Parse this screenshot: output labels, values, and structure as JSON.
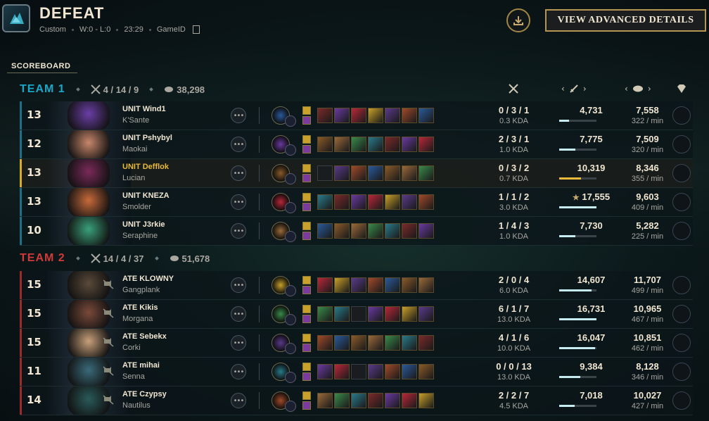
{
  "header": {
    "title": "DEFEAT",
    "mode": "Custom",
    "record": "W:0 - L:0",
    "duration": "23:29",
    "game_id_label": "GameID",
    "advanced_button": "VIEW ADVANCED DETAILS"
  },
  "scoreboard_label": "SCOREBOARD",
  "teams": [
    {
      "name": "TEAM 1",
      "kda": "4 / 14 / 9",
      "gold": "38,298",
      "color": "#1aa7c8",
      "players": [
        {
          "level": "13",
          "name": "UNIT Wind1",
          "champion": "K'Sante",
          "kda": "0 / 3 / 1",
          "kda_ratio": "0.3 KDA",
          "damage": "4,731",
          "damage_pct": 0.27,
          "gold": "7,558",
          "gpm": "322 / min",
          "portrait_color": "#6b3fa6"
        },
        {
          "level": "12",
          "name": "UNIT Pshybyl",
          "champion": "Maokai",
          "kda": "2 / 3 / 1",
          "kda_ratio": "1.0 KDA",
          "damage": "7,775",
          "damage_pct": 0.44,
          "gold": "7,509",
          "gpm": "320 / min",
          "portrait_color": "#c8876b"
        },
        {
          "level": "13",
          "name": "UNIT Defflok",
          "champion": "Lucian",
          "kda": "0 / 3 / 2",
          "kda_ratio": "0.7 KDA",
          "damage": "10,319",
          "damage_pct": 0.59,
          "gold": "8,346",
          "gpm": "355 / min",
          "portrait_color": "#7a2a5a",
          "highlight": true
        },
        {
          "level": "13",
          "name": "UNIT KNEZA",
          "champion": "Smolder",
          "kda": "1 / 1 / 2",
          "kda_ratio": "3.0 KDA",
          "damage": "17,555",
          "damage_star": "★",
          "damage_pct": 1.0,
          "gold": "9,603",
          "gpm": "409 / min",
          "portrait_color": "#c86a3a"
        },
        {
          "level": "10",
          "name": "UNIT J3rkie",
          "champion": "Seraphine",
          "kda": "1 / 4 / 3",
          "kda_ratio": "1.0 KDA",
          "damage": "7,730",
          "damage_pct": 0.44,
          "gold": "5,282",
          "gpm": "225 / min",
          "portrait_color": "#3aa07a"
        }
      ]
    },
    {
      "name": "TEAM 2",
      "kda": "14 / 4 / 37",
      "gold": "51,678",
      "color": "#d23a3a",
      "players": [
        {
          "level": "15",
          "name": "ATE KLOWNY",
          "champion": "Gangplank",
          "kda": "2 / 0 / 4",
          "kda_ratio": "6.0 KDA",
          "damage": "14,607",
          "damage_pct": 0.87,
          "gold": "11,707",
          "gpm": "499 / min",
          "portrait_color": "#5a4a3a"
        },
        {
          "level": "15",
          "name": "ATE Kikis",
          "champion": "Morgana",
          "kda": "6 / 1 / 7",
          "kda_ratio": "13.0 KDA",
          "damage": "16,731",
          "damage_pct": 1.0,
          "gold": "10,965",
          "gpm": "467 / min",
          "portrait_color": "#7a4a3a"
        },
        {
          "level": "15",
          "name": "ATE Sebekx",
          "champion": "Corki",
          "kda": "4 / 1 / 6",
          "kda_ratio": "10.0 KDA",
          "damage": "16,047",
          "damage_pct": 0.96,
          "gold": "10,851",
          "gpm": "462 / min",
          "portrait_color": "#c8a07a"
        },
        {
          "level": "11",
          "name": "ATE mihai",
          "champion": "Senna",
          "kda": "0 / 0 / 13",
          "kda_ratio": "13.0 KDA",
          "damage": "9,384",
          "damage_pct": 0.56,
          "gold": "8,128",
          "gpm": "346 / min",
          "portrait_color": "#3a6a7a"
        },
        {
          "level": "14",
          "name": "ATE Czypsy",
          "champion": "Nautilus",
          "kda": "2 / 2 / 7",
          "kda_ratio": "4.5 KDA",
          "damage": "7,018",
          "damage_pct": 0.42,
          "gold": "10,027",
          "gpm": "427 / min",
          "portrait_color": "#2a5a5a"
        }
      ]
    }
  ]
}
